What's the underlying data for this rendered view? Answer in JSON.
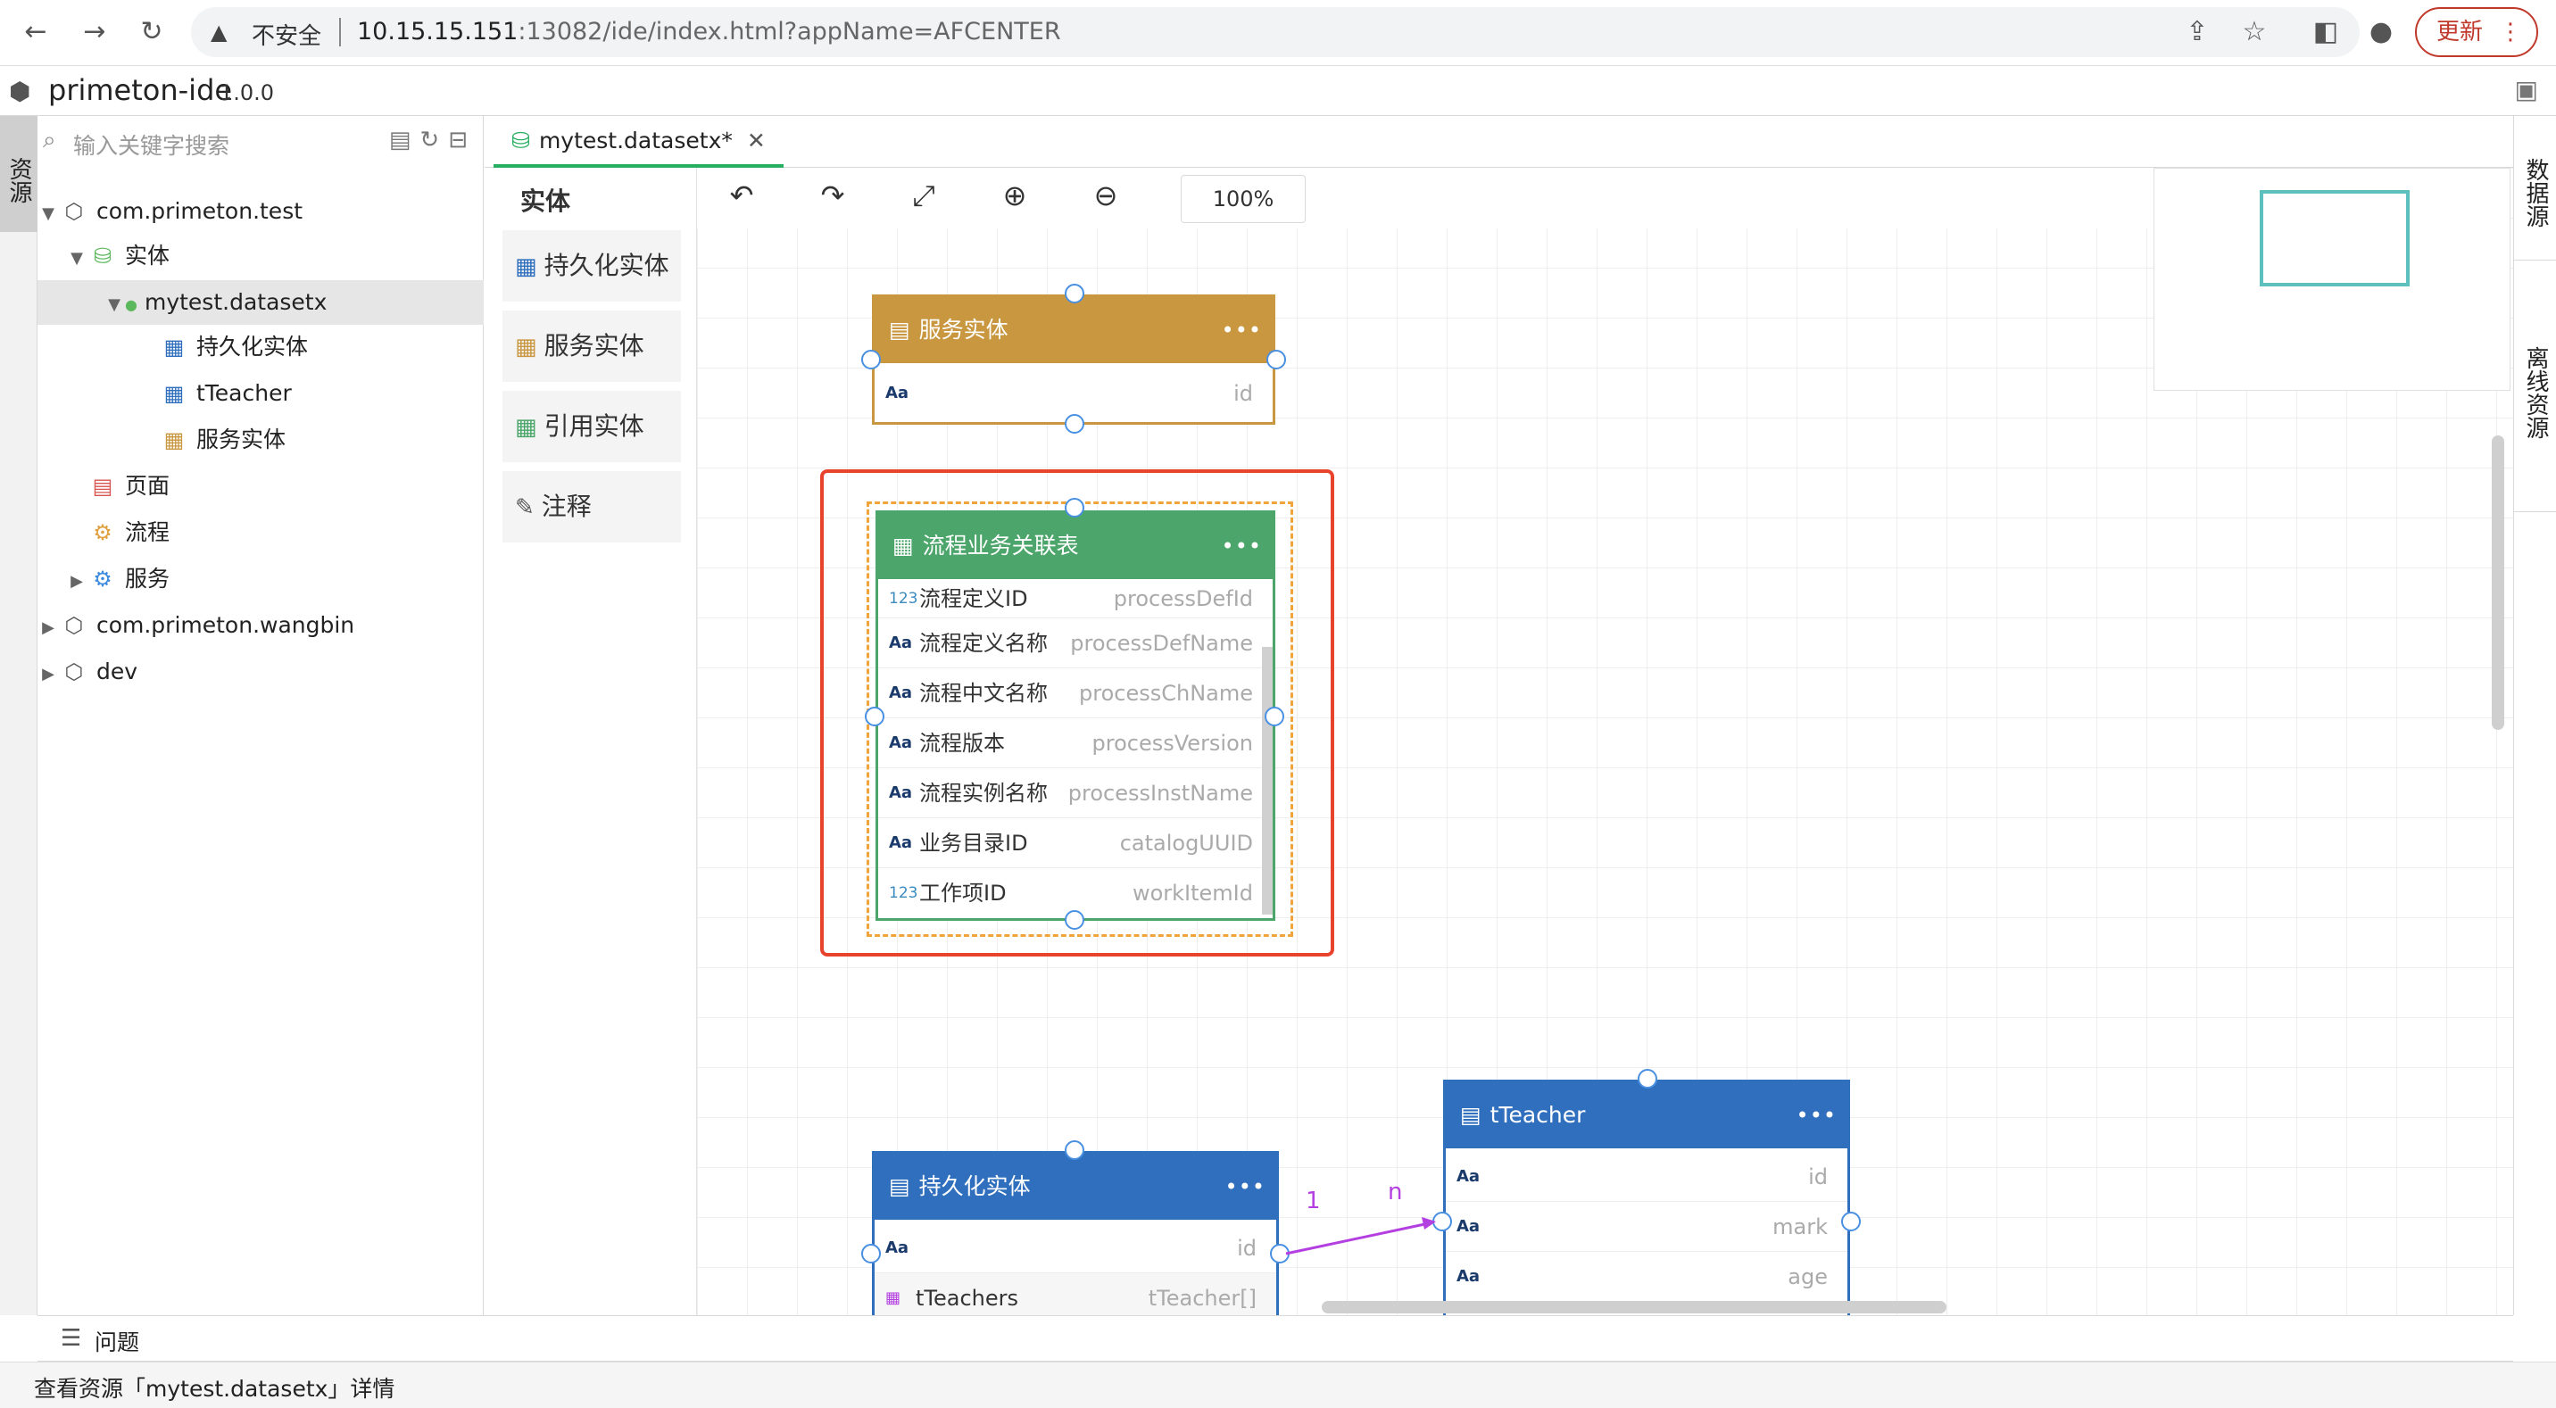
{
  "browser": {
    "insecure_label": "不安全",
    "url_host": "10.15.15.151",
    "url_rest": ":13082/ide/index.html?appName=AFCENTER",
    "update_label": "更新"
  },
  "app": {
    "name": "primeton-ide",
    "version": "1.0.0"
  },
  "left_strip": {
    "tab": "资源"
  },
  "right_strip": {
    "tab1": "数据源",
    "tab2": "离线资源"
  },
  "search": {
    "placeholder": "输入关键字搜索"
  },
  "tree": [
    {
      "label": "com.primeton.test",
      "icon": "package-icon"
    },
    {
      "label": "实体",
      "icon": "database-icon"
    },
    {
      "label": "mytest.datasetx",
      "icon": "dot-icon"
    },
    {
      "label": "持久化实体",
      "icon": "table-icon"
    },
    {
      "label": "tTeacher",
      "icon": "table-icon"
    },
    {
      "label": "服务实体",
      "icon": "service-table-icon"
    },
    {
      "label": "页面",
      "icon": "page-icon"
    },
    {
      "label": "流程",
      "icon": "flow-icon"
    },
    {
      "label": "服务",
      "icon": "gear-icon"
    },
    {
      "label": "com.primeton.wangbin",
      "icon": "package-icon"
    },
    {
      "label": "dev",
      "icon": "package-icon"
    }
  ],
  "editor_tab": {
    "label": "mytest.datasetx*"
  },
  "palette": {
    "title": "实体",
    "items": [
      "持久化实体",
      "服务实体",
      "引用实体",
      "注释"
    ]
  },
  "toolbar": {
    "zoom": "100%"
  },
  "entities": {
    "service": {
      "title": "服务实体",
      "color": "#c9973f",
      "rows": [
        {
          "type": "Aa",
          "label": "",
          "field": "id"
        }
      ]
    },
    "process": {
      "title": "流程业务关联表",
      "color": "#4ca56a",
      "rows": [
        {
          "type": "123",
          "label": "流程定义ID",
          "field": "processDefId"
        },
        {
          "type": "Aa",
          "label": "流程定义名称",
          "field": "processDefName"
        },
        {
          "type": "Aa",
          "label": "流程中文名称",
          "field": "processChName"
        },
        {
          "type": "Aa",
          "label": "流程版本",
          "field": "processVersion"
        },
        {
          "type": "Aa",
          "label": "流程实例名称",
          "field": "processInstName"
        },
        {
          "type": "Aa",
          "label": "业务目录ID",
          "field": "catalogUUID"
        },
        {
          "type": "123",
          "label": "工作项ID",
          "field": "workItemId"
        }
      ]
    },
    "persistent": {
      "title": "持久化实体",
      "color": "#2f6fbd",
      "rows": [
        {
          "type": "Aa",
          "label": "",
          "field": "id"
        },
        {
          "type": "list",
          "label": "tTeachers",
          "field": "tTeacher[]"
        }
      ]
    },
    "teacher": {
      "title": "tTeacher",
      "color": "#2f6fbd",
      "rows": [
        {
          "type": "Aa",
          "label": "",
          "field": "id"
        },
        {
          "type": "Aa",
          "label": "",
          "field": "mark"
        },
        {
          "type": "Aa",
          "label": "",
          "field": "age"
        }
      ]
    }
  },
  "relation": {
    "from_label": "1",
    "to_label": "n",
    "color": "#b43fe0"
  },
  "problems": {
    "label": "问题"
  },
  "status": {
    "text": "查看资源「mytest.datasetx」详情"
  }
}
